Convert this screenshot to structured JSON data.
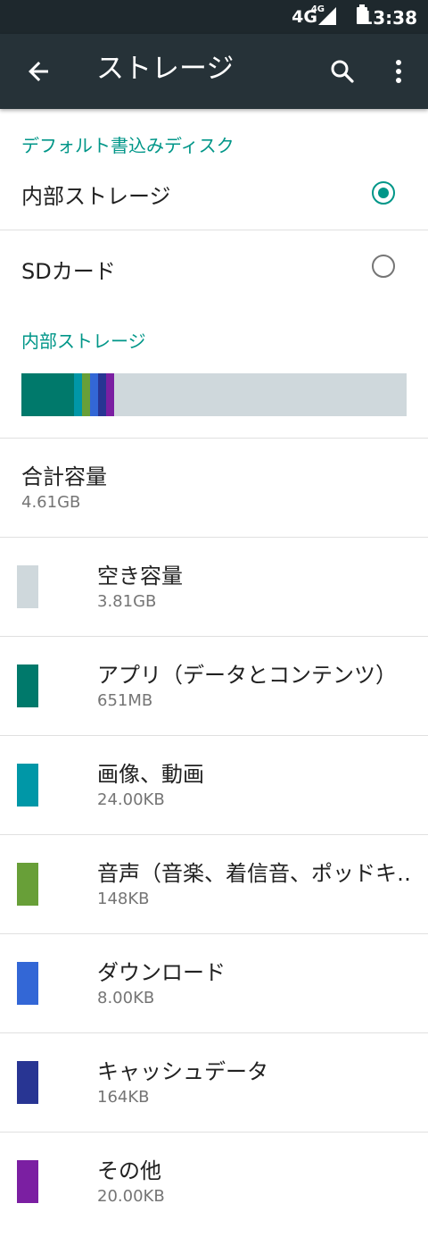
{
  "status_bar": {
    "network": "4G",
    "network_small": "4G",
    "time": "13:38"
  },
  "app_bar": {
    "title": "ストレージ",
    "back_icon": "arrow-back-icon",
    "search_icon": "search-icon",
    "more_icon": "more-vert-icon"
  },
  "default_disk": {
    "header": "デフォルト書込みディスク",
    "options": [
      {
        "label": "内部ストレージ",
        "selected": true
      },
      {
        "label": "SDカード",
        "selected": false
      }
    ]
  },
  "internal_storage": {
    "header": "内部ストレージ",
    "total_title": "合計容量",
    "total_value": "4.61GB"
  },
  "categories": [
    {
      "title": "空き容量",
      "value": "3.81GB",
      "color": "#cfd8dc"
    },
    {
      "title": "アプリ（データとコンテンツ）",
      "value": "651MB",
      "color": "#00796b"
    },
    {
      "title": "画像、動画",
      "value": "24.00KB",
      "color": "#0097a7"
    },
    {
      "title": "音声（音楽、着信音、ポッドキ‥",
      "value": "148KB",
      "color": "#689f38"
    },
    {
      "title": "ダウンロード",
      "value": "8.00KB",
      "color": "#3367d6"
    },
    {
      "title": "キャッシュデータ",
      "value": "164KB",
      "color": "#283593"
    },
    {
      "title": "その他",
      "value": "20.00KB",
      "color": "#7b1fa2"
    }
  ],
  "colors": {
    "accent": "#009688",
    "app_bar": "#263238",
    "status_bar": "#1e282d"
  }
}
